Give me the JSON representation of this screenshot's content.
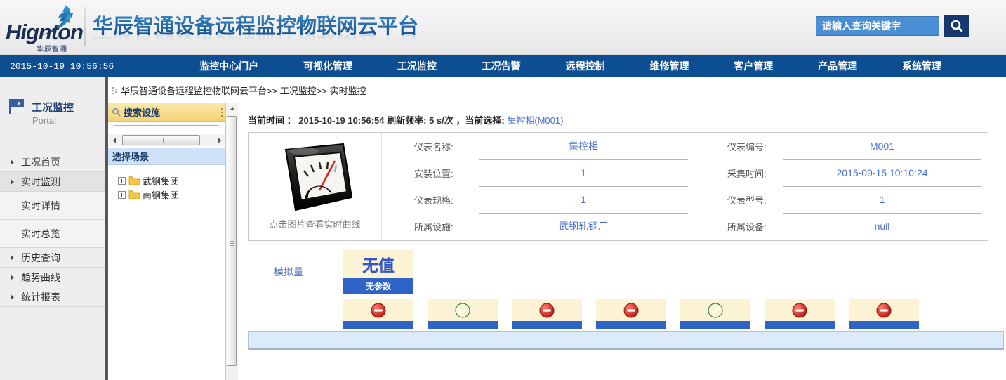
{
  "header": {
    "logo_text": "Hignton",
    "logo_subtext": "华辰智通",
    "site_title": "华辰智通设备远程监控物联网云平台",
    "search_placeholder": "请输入查询关键字"
  },
  "navbar": {
    "timestamp": "2015-10-19 10:56:56",
    "items": [
      "监控中心门户",
      "可视化管理",
      "工况监控",
      "工况告警",
      "远程控制",
      "维修管理",
      "客户管理",
      "产品管理",
      "系统管理"
    ]
  },
  "sidebar": {
    "portal_title": "工况监控",
    "portal_subtitle": "Portal",
    "items": [
      {
        "label": "工况首页"
      },
      {
        "label": "实时监测"
      },
      {
        "label": "实时详情"
      },
      {
        "label": "实时总览"
      },
      {
        "label": "历史查询"
      },
      {
        "label": "趋势曲线"
      },
      {
        "label": "统计报表"
      }
    ]
  },
  "breadcrumb": {
    "text": "华辰智通设备远程监控物联网云平台>> 工况监控>> 实时监控"
  },
  "tree_panel": {
    "search_header": "搜索设施",
    "scene_header": "选择场景",
    "nodes": [
      {
        "label": "武钢集团"
      },
      {
        "label": "南钢集团"
      }
    ]
  },
  "main": {
    "time_label": "当前时间",
    "time_sep": "：",
    "time_value": "2015-10-19 10:56:54",
    "refresh_label": "刷新频率:",
    "refresh_value": "5  s/次",
    "selection_label": "，当前选择:",
    "selection_value": "集控相(M001)",
    "gauge_caption": "点击图片查看实时曲线",
    "info_fields": [
      {
        "label": "仪表名称:",
        "value": "集控相"
      },
      {
        "label": "仪表编号:",
        "value": "M001"
      },
      {
        "label": "安装位置:",
        "value": "1"
      },
      {
        "label": "采集时间:",
        "value": "2015-09-15 10:10:24"
      },
      {
        "label": "仪表规格:",
        "value": "1"
      },
      {
        "label": "仪表型号:",
        "value": "1"
      },
      {
        "label": "所属设施:",
        "value": "武钢轧钢厂"
      },
      {
        "label": "所属设备:",
        "value": "null"
      }
    ],
    "analog": {
      "section_label": "模拟量",
      "no_value": "无值",
      "no_param": "无参数",
      "statuses": [
        "blocked",
        "ok",
        "blocked",
        "blocked",
        "ok",
        "blocked",
        "blocked"
      ]
    }
  },
  "colors": {
    "navy": "#0d4d92",
    "navy_btn": "#16396d",
    "accent_blue": "#4a8fd4",
    "link_blue": "#4a6fd4",
    "cream": "#fcf3d4",
    "bar_blue": "#2e63c8",
    "status_red": "#cc1810",
    "status_green": "#21a035",
    "highlight": "#dcebfa"
  }
}
